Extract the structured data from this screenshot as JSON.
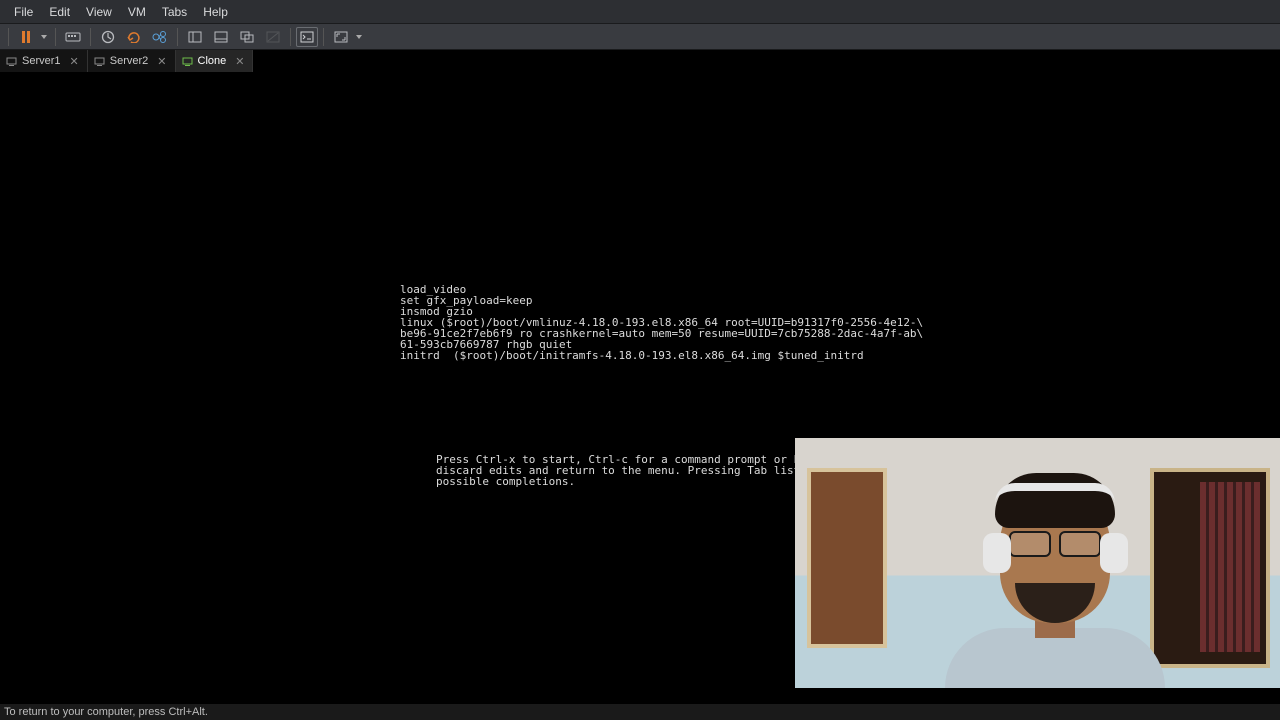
{
  "menubar": {
    "items": [
      "File",
      "Edit",
      "View",
      "VM",
      "Tabs",
      "Help"
    ]
  },
  "toolbar": {
    "power_state": "pause",
    "icons": {
      "send_cad": "send-ctrl-alt-del-icon",
      "snapshot": "snapshot-icon",
      "revert": "revert-snapshot-icon",
      "manage_snap": "snapshot-manager-icon",
      "single": "single-window-icon",
      "multi": "multiple-windows-icon",
      "unity": "unity-icon",
      "console": "console-view-icon",
      "fullscreen": "fullscreen-icon"
    }
  },
  "tabs": [
    {
      "label": "Server1",
      "active": false
    },
    {
      "label": "Server2",
      "active": false
    },
    {
      "label": "Clone",
      "active": true
    }
  ],
  "grub": {
    "lines": [
      "load_video",
      "set gfx_payload=keep",
      "insmod gzio",
      "linux ($root)/boot/vmlinuz-4.18.0-193.el8.x86_64 root=UUID=b91317f0-2556-4e12-\\",
      "be96-91ce2f7eb6f9 ro crashkernel=auto mem=50 resume=UUID=7cb75288-2dac-4a7f-ab\\",
      "61-593cb7669787 rhgb quiet",
      "initrd  ($root)/boot/initramfs-4.18.0-193.el8.x86_64.img $tuned_initrd"
    ],
    "help": [
      "Press Ctrl-x to start, Ctrl-c for a command prompt or Escape",
      "discard edits and return to the menu. Pressing Tab lists",
      "possible completions."
    ]
  },
  "statusbar": {
    "hint": "To return to your computer, press Ctrl+Alt."
  }
}
